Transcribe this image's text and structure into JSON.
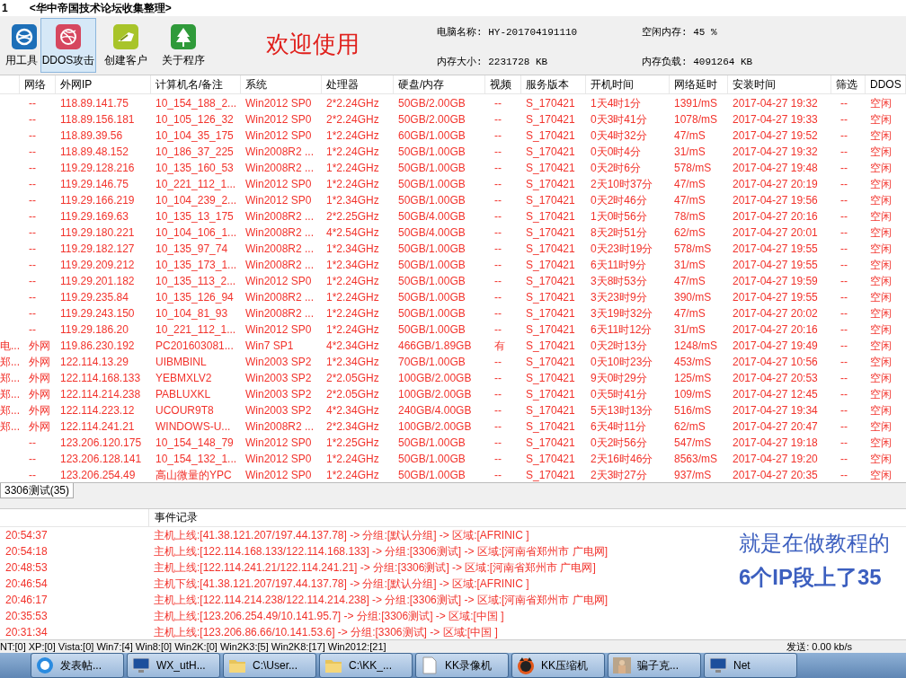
{
  "window": {
    "number": "1",
    "title": "<华中帝国技术论坛收集整理>"
  },
  "toolbar": {
    "buttons": [
      {
        "label": "用工具",
        "selected": false
      },
      {
        "label": "DDOS攻击",
        "selected": true
      },
      {
        "label": "创建客户",
        "selected": false
      },
      {
        "label": "关于程序",
        "selected": false
      }
    ],
    "welcome": "欢迎使用",
    "info": [
      {
        "label": "电脑名称:",
        "value": "HY-201704191110"
      },
      {
        "label": "空闲内存:",
        "value": "45 %"
      },
      {
        "label": "内存大小:",
        "value": "2231728 KB"
      },
      {
        "label": "内存负载:",
        "value": "4091264 KB"
      }
    ]
  },
  "table": {
    "columns": [
      "",
      "网络",
      "外网IP",
      "计算机名/备注",
      "系统",
      "处理器",
      "硬盘/内存",
      "视频",
      "服务版本",
      "开机时间",
      "网络延时",
      "安装时间",
      "筛选",
      "DDOS"
    ],
    "rows": [
      [
        "",
        "--",
        "118.89.141.75",
        "10_154_188_2...",
        "Win2012 SP0",
        "2*2.24GHz",
        "50GB/2.00GB",
        "--",
        "S_170421",
        "1天4时1分",
        "1391/mS",
        "2017-04-27 19:32",
        "--",
        "空闲"
      ],
      [
        "",
        "--",
        "118.89.156.181",
        "10_105_126_32",
        "Win2012 SP0",
        "2*2.24GHz",
        "50GB/2.00GB",
        "--",
        "S_170421",
        "0天3时41分",
        "1078/mS",
        "2017-04-27 19:33",
        "--",
        "空闲"
      ],
      [
        "",
        "--",
        "118.89.39.56",
        "10_104_35_175",
        "Win2012 SP0",
        "1*2.24GHz",
        "60GB/1.00GB",
        "--",
        "S_170421",
        "0天4时32分",
        "47/mS",
        "2017-04-27 19:52",
        "--",
        "空闲"
      ],
      [
        "",
        "--",
        "118.89.48.152",
        "10_186_37_225",
        "Win2008R2 ...",
        "1*2.24GHz",
        "50GB/1.00GB",
        "--",
        "S_170421",
        "0天0时4分",
        "31/mS",
        "2017-04-27 19:32",
        "--",
        "空闲"
      ],
      [
        "",
        "--",
        "119.29.128.216",
        "10_135_160_53",
        "Win2008R2 ...",
        "1*2.24GHz",
        "50GB/1.00GB",
        "--",
        "S_170421",
        "0天2时6分",
        "578/mS",
        "2017-04-27 19:48",
        "--",
        "空闲"
      ],
      [
        "",
        "--",
        "119.29.146.75",
        "10_221_112_1...",
        "Win2012 SP0",
        "1*2.24GHz",
        "50GB/1.00GB",
        "--",
        "S_170421",
        "2天10时37分",
        "47/mS",
        "2017-04-27 20:19",
        "--",
        "空闲"
      ],
      [
        "",
        "--",
        "119.29.166.219",
        "10_104_239_2...",
        "Win2012 SP0",
        "1*2.34GHz",
        "50GB/1.00GB",
        "--",
        "S_170421",
        "0天2时46分",
        "47/mS",
        "2017-04-27 19:56",
        "--",
        "空闲"
      ],
      [
        "",
        "--",
        "119.29.169.63",
        "10_135_13_175",
        "Win2008R2 ...",
        "2*2.25GHz",
        "50GB/4.00GB",
        "--",
        "S_170421",
        "1天0时56分",
        "78/mS",
        "2017-04-27 20:16",
        "--",
        "空闲"
      ],
      [
        "",
        "--",
        "119.29.180.221",
        "10_104_106_1...",
        "Win2008R2 ...",
        "4*2.54GHz",
        "50GB/4.00GB",
        "--",
        "S_170421",
        "8天2时51分",
        "62/mS",
        "2017-04-27 20:01",
        "--",
        "空闲"
      ],
      [
        "",
        "--",
        "119.29.182.127",
        "10_135_97_74",
        "Win2008R2 ...",
        "1*2.34GHz",
        "50GB/1.00GB",
        "--",
        "S_170421",
        "0天23时19分",
        "578/mS",
        "2017-04-27 19:55",
        "--",
        "空闲"
      ],
      [
        "",
        "--",
        "119.29.209.212",
        "10_135_173_1...",
        "Win2008R2 ...",
        "1*2.34GHz",
        "50GB/1.00GB",
        "--",
        "S_170421",
        "6天11时9分",
        "31/mS",
        "2017-04-27 19:55",
        "--",
        "空闲"
      ],
      [
        "",
        "--",
        "119.29.201.182",
        "10_135_113_2...",
        "Win2012 SP0",
        "1*2.24GHz",
        "50GB/1.00GB",
        "--",
        "S_170421",
        "3天8时53分",
        "47/mS",
        "2017-04-27 19:59",
        "--",
        "空闲"
      ],
      [
        "",
        "--",
        "119.29.235.84",
        "10_135_126_94",
        "Win2008R2 ...",
        "1*2.24GHz",
        "50GB/1.00GB",
        "--",
        "S_170421",
        "3天23时9分",
        "390/mS",
        "2017-04-27 19:55",
        "--",
        "空闲"
      ],
      [
        "",
        "--",
        "119.29.243.150",
        "10_104_81_93",
        "Win2008R2 ...",
        "1*2.24GHz",
        "50GB/1.00GB",
        "--",
        "S_170421",
        "3天19时32分",
        "47/mS",
        "2017-04-27 20:02",
        "--",
        "空闲"
      ],
      [
        "",
        "--",
        "119.29.186.20",
        "10_221_112_1...",
        "Win2012 SP0",
        "1*2.24GHz",
        "50GB/1.00GB",
        "--",
        "S_170421",
        "6天11时12分",
        "31/mS",
        "2017-04-27 20:16",
        "--",
        "空闲"
      ],
      [
        "电...",
        "外网",
        "119.86.230.192",
        "PC201603081...",
        "Win7 SP1",
        "4*2.34GHz",
        "466GB/1.89GB",
        "有",
        "S_170421",
        "0天2时13分",
        "1248/mS",
        "2017-04-27 19:49",
        "--",
        "空闲"
      ],
      [
        "郑...",
        "外网",
        "122.114.13.29",
        "UIBMBINL",
        "Win2003 SP2",
        "1*2.34GHz",
        "70GB/1.00GB",
        "--",
        "S_170421",
        "0天10时23分",
        "453/mS",
        "2017-04-27 10:56",
        "--",
        "空闲"
      ],
      [
        "郑...",
        "外网",
        "122.114.168.133",
        "YEBMXLV2",
        "Win2003 SP2",
        "2*2.05GHz",
        "100GB/2.00GB",
        "--",
        "S_170421",
        "9天0时29分",
        "125/mS",
        "2017-04-27 20:53",
        "--",
        "空闲"
      ],
      [
        "郑...",
        "外网",
        "122.114.214.238",
        "PABLUXKL",
        "Win2003 SP2",
        "2*2.05GHz",
        "100GB/2.00GB",
        "--",
        "S_170421",
        "0天5时41分",
        "109/mS",
        "2017-04-27 12:45",
        "--",
        "空闲"
      ],
      [
        "郑...",
        "外网",
        "122.114.223.12",
        "UCOUR9T8",
        "Win2003 SP2",
        "4*2.34GHz",
        "240GB/4.00GB",
        "--",
        "S_170421",
        "5天13时13分",
        "516/mS",
        "2017-04-27 19:34",
        "--",
        "空闲"
      ],
      [
        "郑...",
        "外网",
        "122.114.241.21",
        "WINDOWS-U...",
        "Win2008R2 ...",
        "2*2.34GHz",
        "100GB/2.00GB",
        "--",
        "S_170421",
        "6天4时11分",
        "62/mS",
        "2017-04-27 20:47",
        "--",
        "空闲"
      ],
      [
        "",
        "--",
        "123.206.120.175",
        "10_154_148_79",
        "Win2012 SP0",
        "1*2.25GHz",
        "50GB/1.00GB",
        "--",
        "S_170421",
        "0天2时56分",
        "547/mS",
        "2017-04-27 19:18",
        "--",
        "空闲"
      ],
      [
        "",
        "--",
        "123.206.128.141",
        "10_154_132_1...",
        "Win2012 SP0",
        "1*2.24GHz",
        "50GB/1.00GB",
        "--",
        "S_170421",
        "2天16时46分",
        "8563/mS",
        "2017-04-27 19:20",
        "--",
        "空闲"
      ],
      [
        "",
        "--",
        "123.206.254.49",
        "高山微量的YPC",
        "Win2012 SP0",
        "1*2.24GHz",
        "50GB/1.00GB",
        "--",
        "S_170421",
        "2天3时27分",
        "937/mS",
        "2017-04-27 20:35",
        "--",
        "空闲"
      ]
    ]
  },
  "group_tabs": [
    {
      "label": "3306测试(35)",
      "selected": true
    }
  ],
  "event_log": {
    "header": "事件记录",
    "rows": [
      {
        "time": "20:54:37",
        "text": "主机上线:[41.38.121.207/197.44.137.78] -> 分组:[默认分组] -> 区域:[AFRINIC ]"
      },
      {
        "time": "20:54:18",
        "text": "主机上线:[122.114.168.133/122.114.168.133] -> 分组:[3306测试] -> 区域:[河南省郑州市 广电网]"
      },
      {
        "time": "20:48:53",
        "text": "主机上线:[122.114.241.21/122.114.241.21] -> 分组:[3306测试] -> 区域:[河南省郑州市 广电网]"
      },
      {
        "time": "20:46:54",
        "text": "主机下线:[41.38.121.207/197.44.137.78] -> 分组:[默认分组] -> 区域:[AFRINIC ]"
      },
      {
        "time": "20:46:17",
        "text": "主机上线:[122.114.214.238/122.114.214.238] -> 分组:[3306测试] -> 区域:[河南省郑州市 广电网]"
      },
      {
        "time": "20:35:53",
        "text": "主机上线:[123.206.254.49/10.141.95.7] -> 分组:[3306测试] -> 区域:[中国 ]"
      },
      {
        "time": "20:31:34",
        "text": "主机上线:[123.206.86.66/10.141.53.6] -> 分组:[3306测试] -> 区域:[中国 ]"
      }
    ],
    "note": [
      "就是在做教程的",
      "6个IP段上了35"
    ]
  },
  "status_bar": {
    "counts": "NT:[0] XP:[0] Vista:[0] Win7:[4] Win8:[0] Win2K:[0] Win2K3:[5] Win2K8:[17] Win2012:[21]",
    "send": "发送: 0.00 kb/s"
  },
  "taskbar": [
    {
      "label": "发表帖...",
      "selected": false
    },
    {
      "label": "WX_utH...",
      "selected": false
    },
    {
      "label": "C:\\User...",
      "selected": false
    },
    {
      "label": "C:\\KK_...",
      "selected": false
    },
    {
      "label": "KK录像机",
      "selected": false
    },
    {
      "label": "KK压缩机",
      "selected": false
    },
    {
      "label": "骗子克...",
      "selected": false
    },
    {
      "label": "Net",
      "selected": false
    }
  ]
}
